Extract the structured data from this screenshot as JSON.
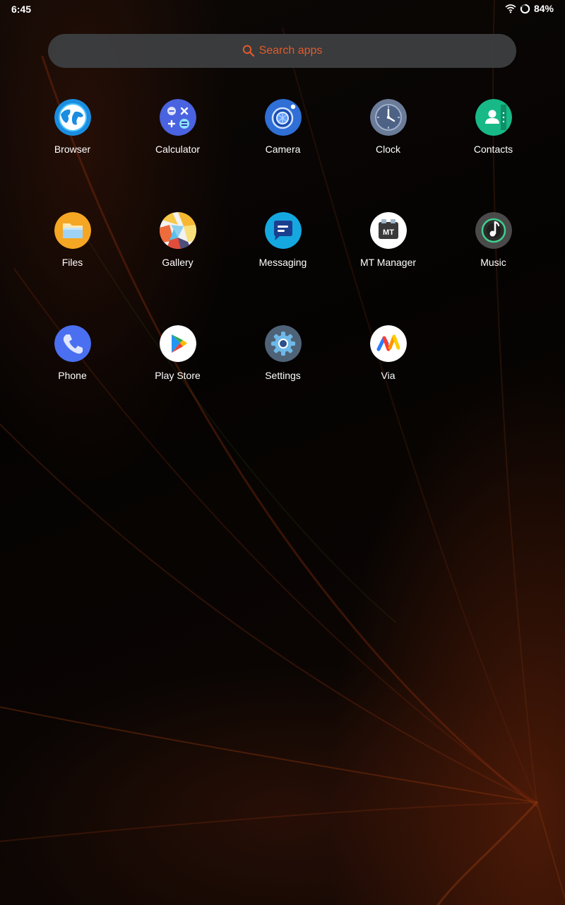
{
  "status_bar": {
    "time": "6:45",
    "battery_percent": "84%",
    "icons": [
      "wifi-icon",
      "battery-ring-icon"
    ]
  },
  "search": {
    "label": "Search apps",
    "icon": "search-icon"
  },
  "apps": [
    {
      "label": "Browser",
      "icon": "browser-icon"
    },
    {
      "label": "Calculator",
      "icon": "calculator-icon"
    },
    {
      "label": "Camera",
      "icon": "camera-icon"
    },
    {
      "label": "Clock",
      "icon": "clock-icon"
    },
    {
      "label": "Contacts",
      "icon": "contacts-icon"
    },
    {
      "label": "Files",
      "icon": "files-icon"
    },
    {
      "label": "Gallery",
      "icon": "gallery-icon"
    },
    {
      "label": "Messaging",
      "icon": "messaging-icon"
    },
    {
      "label": "MT Manager",
      "icon": "mt-manager-icon",
      "icon_text": "MT"
    },
    {
      "label": "Music",
      "icon": "music-icon"
    },
    {
      "label": "Phone",
      "icon": "phone-icon"
    },
    {
      "label": "Play Store",
      "icon": "play-store-icon"
    },
    {
      "label": "Settings",
      "icon": "settings-icon"
    },
    {
      "label": "Via",
      "icon": "via-icon"
    }
  ],
  "colors": {
    "search_accent": "#e35a2a",
    "search_bg": "#3e4042",
    "label_text": "#ffffff"
  }
}
